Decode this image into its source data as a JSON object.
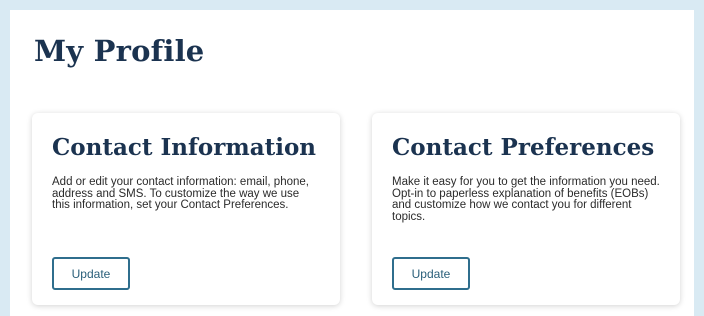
{
  "page": {
    "title": "My Profile"
  },
  "cards": [
    {
      "title": "Contact Information",
      "description": "Add or edit your contact information: email, phone, address and SMS. To customize the way we use this information, set your Contact Preferences.",
      "button_label": "Update"
    },
    {
      "title": "Contact Preferences",
      "description": "Make it easy for you to get the information you need. Opt-in to paperless explanation of benefits (EOBs) and customize how we contact you for different topics.",
      "button_label": "Update"
    }
  ],
  "colors": {
    "background": "#d9eaf3",
    "heading": "#1b3350",
    "button_border": "#2f6e8d"
  }
}
